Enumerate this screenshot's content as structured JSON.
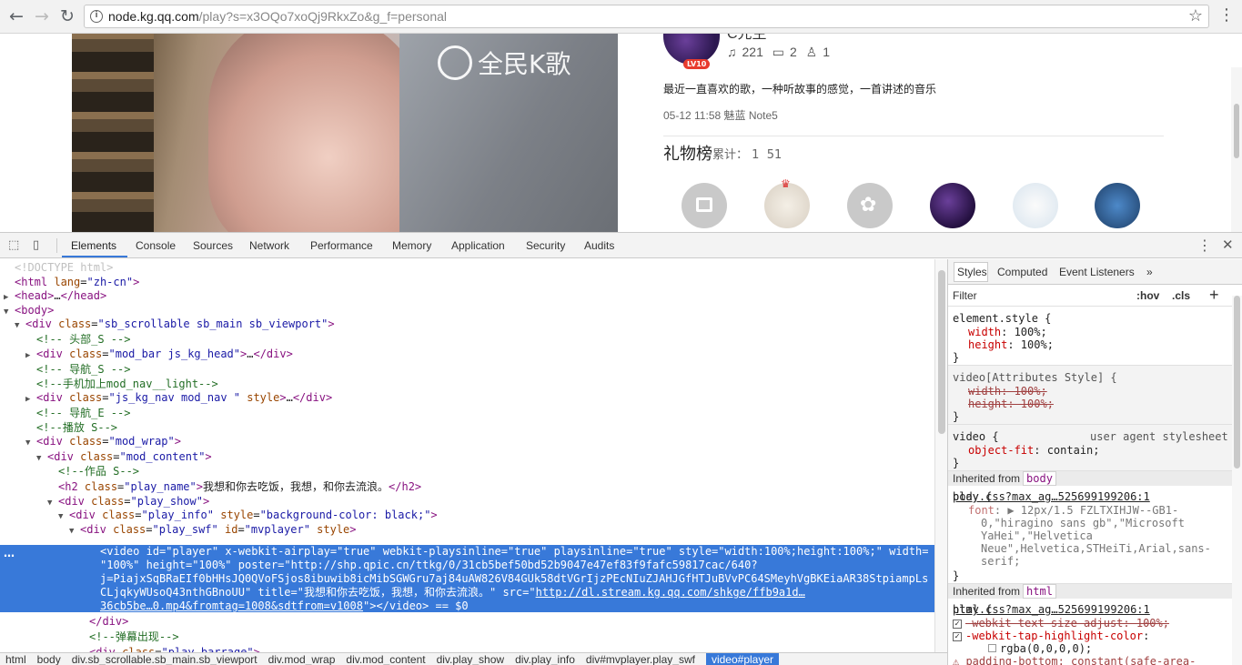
{
  "browser": {
    "url_host": "node.kg.qq.com",
    "url_path": "/play?s=x3OQo7xoQj9RkxZo&g_f=personal"
  },
  "page": {
    "video_logo": "全民K歌",
    "user_name_partial": "C先生",
    "stats": {
      "listens": "221",
      "comments": "2",
      "gifts": "1"
    },
    "level_badge": "LV10",
    "description": "最近一直喜欢的歌，一种听故事的感觉，一首讲述的音乐",
    "meta": "05-12 11:58 魅蓝 Note5",
    "gift_title": "礼物榜",
    "gift_count_label": "累计：",
    "gift_count_a": "1",
    "gift_count_b": "51"
  },
  "devtools": {
    "tabs": [
      "Elements",
      "Console",
      "Sources",
      "Network",
      "Performance",
      "Memory",
      "Application",
      "Security",
      "Audits"
    ],
    "active_tab": "Elements",
    "dom_lines": [
      {
        "indent": 0,
        "tri": "",
        "html": "<span class='dt'>&lt;!DOCTYPE html&gt;</span>"
      },
      {
        "indent": 0,
        "tri": "",
        "html": "<span class='tag'>&lt;html</span> <span class='an'>lang</span>=<span class='av'>\"zh-cn\"</span><span class='tag'>&gt;</span>"
      },
      {
        "indent": 0,
        "tri": "▶",
        "html": "<span class='tag'>&lt;head&gt;</span>…<span class='tag'>&lt;/head&gt;</span>"
      },
      {
        "indent": 0,
        "tri": "▼",
        "html": "<span class='tag'>&lt;body&gt;</span>"
      },
      {
        "indent": 1,
        "tri": "▼",
        "html": "<span class='tag'>&lt;div</span> <span class='an'>class</span>=<span class='av'>\"sb_scrollable sb_main sb_viewport\"</span><span class='tag'>&gt;</span>"
      },
      {
        "indent": 2,
        "tri": "",
        "html": "<span class='cm'>&lt;!-- 头部_S --&gt;</span>"
      },
      {
        "indent": 2,
        "tri": "▶",
        "html": "<span class='tag'>&lt;div</span> <span class='an'>class</span>=<span class='av'>\"mod_bar js_kg_head\"</span><span class='tag'>&gt;</span>…<span class='tag'>&lt;/div&gt;</span>"
      },
      {
        "indent": 2,
        "tri": "",
        "html": "<span class='cm'>&lt;!-- 导航_S --&gt;</span>"
      },
      {
        "indent": 2,
        "tri": "",
        "html": "<span class='cm'>&lt;!--手机加上mod_nav__light--&gt;</span>"
      },
      {
        "indent": 2,
        "tri": "▶",
        "html": "<span class='tag'>&lt;div</span> <span class='an'>class</span>=<span class='av'>\"js_kg_nav mod_nav \"</span> <span class='an'>style</span><span class='tag'>&gt;</span>…<span class='tag'>&lt;/div&gt;</span>"
      },
      {
        "indent": 2,
        "tri": "",
        "html": "<span class='cm'>&lt;!-- 导航_E --&gt;</span>"
      },
      {
        "indent": 2,
        "tri": "",
        "html": "<span class='cm'>&lt;!--播放 S--&gt;</span>"
      },
      {
        "indent": 2,
        "tri": "▼",
        "html": "<span class='tag'>&lt;div</span> <span class='an'>class</span>=<span class='av'>\"mod_wrap\"</span><span class='tag'>&gt;</span>"
      },
      {
        "indent": 3,
        "tri": "▼",
        "html": "<span class='tag'>&lt;div</span> <span class='an'>class</span>=<span class='av'>\"mod_content\"</span><span class='tag'>&gt;</span>"
      },
      {
        "indent": 4,
        "tri": "",
        "html": "<span class='cm'>&lt;!--作品 S--&gt;</span>"
      },
      {
        "indent": 4,
        "tri": "",
        "html": "<span class='tag'>&lt;h2</span> <span class='an'>class</span>=<span class='av'>\"play_name\"</span><span class='tag'>&gt;</span>我想和你去吃饭，我想，和你去流浪。<span class='tag'>&lt;/h2&gt;</span>"
      },
      {
        "indent": 4,
        "tri": "▼",
        "html": "<span class='tag'>&lt;div</span> <span class='an'>class</span>=<span class='av'>\"play_show\"</span><span class='tag'>&gt;</span>"
      },
      {
        "indent": 5,
        "tri": "▼",
        "html": "<span class='tag'>&lt;div</span> <span class='an'>class</span>=<span class='av'>\"play_info\"</span> <span class='an'>style</span>=<span class='av'>\"background-color: black;\"</span><span class='tag'>&gt;</span>"
      },
      {
        "indent": 6,
        "tri": "▼",
        "html": "<span class='tag'>&lt;div</span> <span class='an'>class</span>=<span class='av'>\"play_swf\"</span> <span class='an'>id</span>=<span class='av'>\"mvplayer\"</span> <span class='an'>style</span><span class='tag'>&gt;</span>"
      }
    ],
    "selected_lines": [
      "<span class='tag'>&lt;video</span> <span class='an'>id</span>=<span class='av'>\"player\"</span> <span class='an'>x-webkit-airplay</span>=<span class='av'>\"true\"</span> <span class='an'>webkit-playsinline</span>=<span class='av'>\"true\"</span> <span class='an'>playsinline</span>=<span class='av'>\"true\"</span> <span class='an'>style</span>=<span class='av'>\"width:100%;height:100%;\"</span> <span class='an'>width</span>=",
      "<span class='av'>\"100%\"</span> <span class='an'>height</span>=<span class='av'>\"100%\"</span> <span class='an'>poster</span>=<span class='av'>\"http://shp.qpic.cn/ttkg/0/31cb5bef50bd52b9047e47ef83f9fafc59817cac/640?</span>",
      "<span class='av'>j=PiajxSqBRaEIf0bHHsJQ0QVoFSjos8ibuwib8icMibSGWGru7aj84uAW826V84GUk58dtVGrIjzPEcNIuZJAHJGfHTJuBVvPC64SMeyhVgBKEiaAR38StpiampLs</span>",
      "<span class='av'>CLjqkyWUsoQ43nthGBnoUU\"</span> <span class='an'>title</span>=<span class='av'>\"我想和你去吃饭，我想，和你去流浪。\"</span> <span class='an'>src</span>=<span class='av'>\"</span><span class='lk'>http://dl.stream.kg.qq.com/shkge/ffb9a1d…</span>",
      "<span class='lk'>36cb5be…0.mp4&amp;fromtag=1008&amp;sdtfrom=v1008</span><span class='av'>\"</span><span class='tag'>&gt;&lt;/video&gt;</span> <span class='tx'>== $0</span>"
    ],
    "after_lines": [
      {
        "indent": 7,
        "tri": "",
        "html": "<span class='tag'>&lt;/div&gt;</span>"
      },
      {
        "indent": 7,
        "tri": "",
        "html": "<span class='cm'>&lt;!--弹幕出现--&gt;</span>"
      },
      {
        "indent": 7,
        "tri": "",
        "html": "<span class='tag'>&lt;div</span> <span class='an'>class</span>=<span class='av'>\"play_barrage\"</span><span class='tag'>&gt;</span>"
      }
    ],
    "breadcrumb": [
      "html",
      "body",
      "div.sb_scrollable.sb_main.sb_viewport",
      "div.mod_wrap",
      "div.mod_content",
      "div.play_show",
      "div.play_info",
      "div#mvplayer.play_swf",
      "video#player"
    ],
    "styles_tabs": [
      "Styles",
      "Computed",
      "Event Listeners",
      "»"
    ],
    "filter_placeholder": "Filter",
    "hov": ":hov",
    "cls": ".cls",
    "plus": "+",
    "inherited_label": "Inherited from",
    "inherited_body": "body",
    "inherited_html": "html",
    "play_css_link": "play.css?max_ag…525699199206:1",
    "ua_label": "user agent stylesheet"
  }
}
